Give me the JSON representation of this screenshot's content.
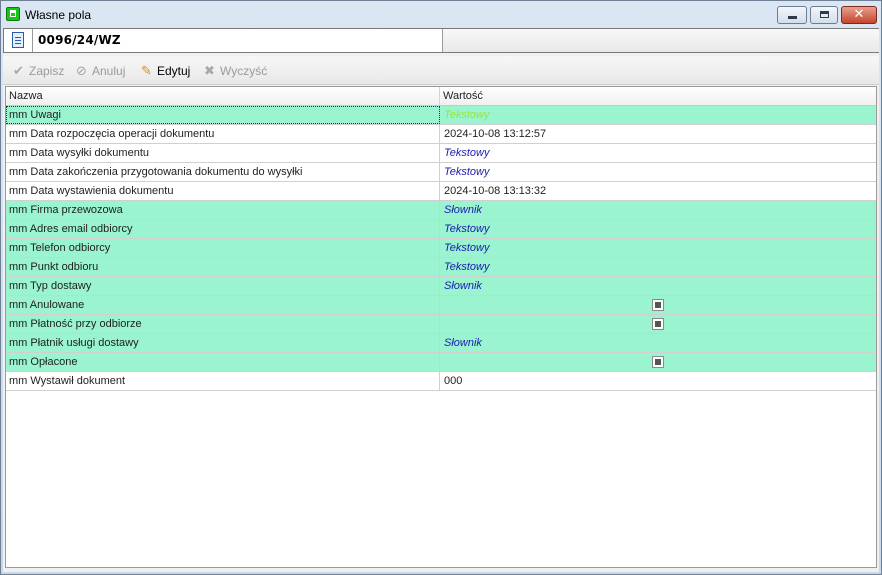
{
  "window": {
    "title": "Własne pola"
  },
  "document": {
    "number": "0096/24/WZ"
  },
  "toolbar": {
    "save": "Zapisz",
    "cancel": "Anuluj",
    "edit": "Edytuj",
    "clear": "Wyczyść"
  },
  "grid": {
    "headers": {
      "name": "Nazwa",
      "value": "Wartość"
    },
    "rows": [
      {
        "name": "mm Uwagi",
        "value": "Tekstowy"
      },
      {
        "name": "mm Data rozpoczęcia operacji dokumentu",
        "value": "2024-10-08 13:12:57"
      },
      {
        "name": "mm Data wysyłki dokumentu",
        "value": "Tekstowy"
      },
      {
        "name": "mm Data zakończenia przygotowania dokumentu do wysyłki",
        "value": "Tekstowy"
      },
      {
        "name": "mm Data wystawienia dokumentu",
        "value": "2024-10-08 13:13:32"
      },
      {
        "name": "mm Firma przewozowa",
        "value": "Słownik"
      },
      {
        "name": "mm Adres email odbiorcy",
        "value": "Tekstowy"
      },
      {
        "name": "mm Telefon odbiorcy",
        "value": "Tekstowy"
      },
      {
        "name": "mm Punkt odbioru",
        "value": "Tekstowy"
      },
      {
        "name": "mm Typ dostawy",
        "value": "Słownik"
      },
      {
        "name": "mm Anulowane",
        "value": ""
      },
      {
        "name": "mm Płatność przy odbiorze",
        "value": ""
      },
      {
        "name": "mm Płatnik usługi dostawy",
        "value": "Słownik"
      },
      {
        "name": "mm Opłacone",
        "value": ""
      },
      {
        "name": "mm Wystawił dokument",
        "value": "000"
      }
    ]
  },
  "colors": {
    "row_highlight": "#99f4cf",
    "type_text": "#1c1cb0",
    "selected_type_text": "#9de43a"
  }
}
